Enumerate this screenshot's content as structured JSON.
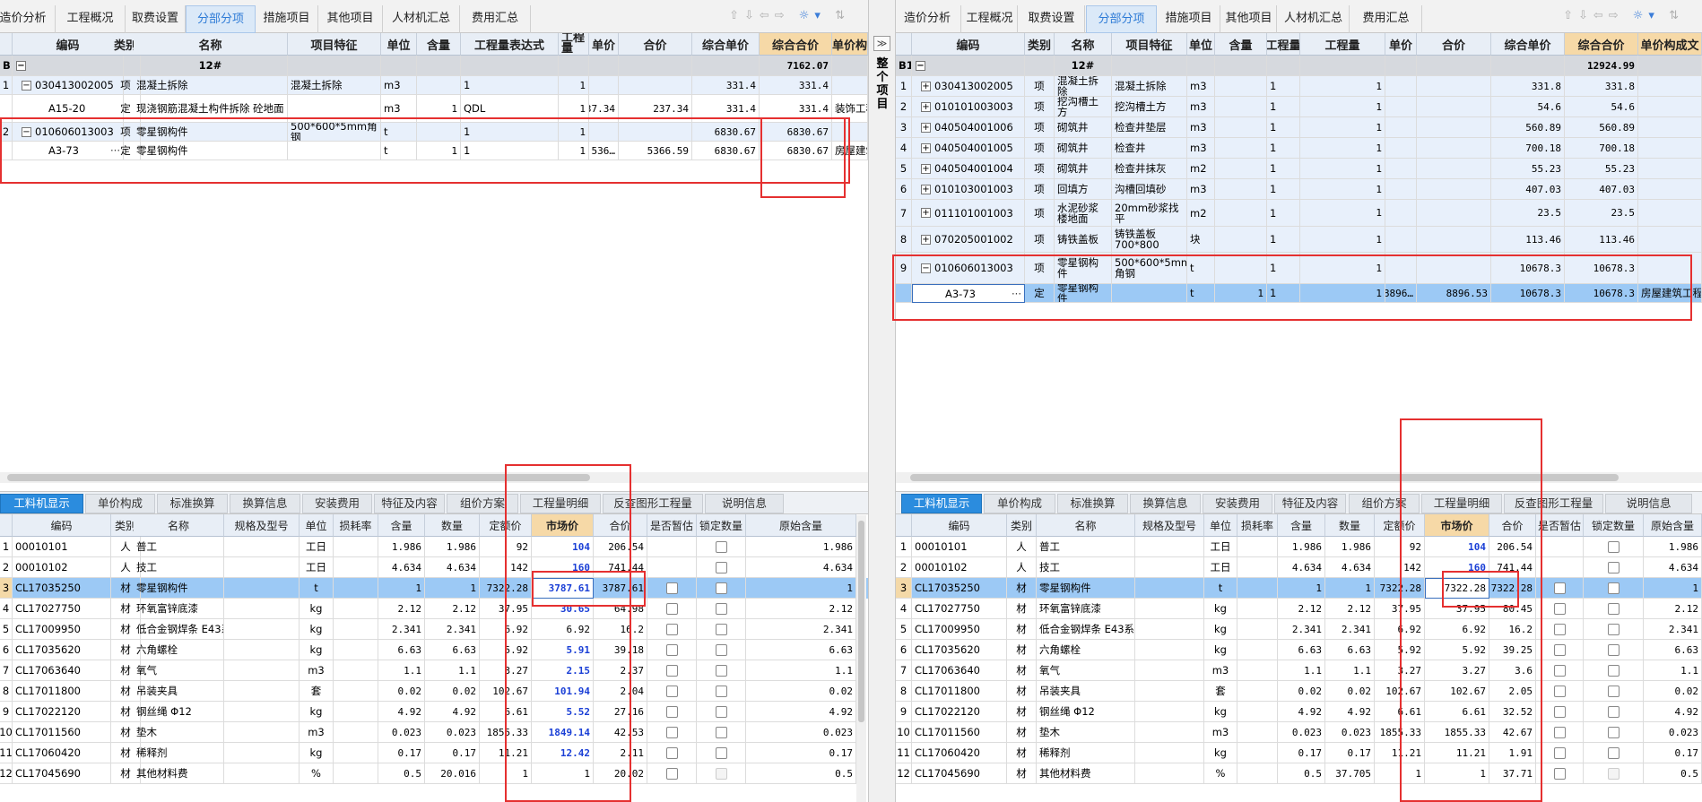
{
  "left": {
    "tabs": [
      "造价分析",
      "工程概况",
      "取费设置",
      "分部分项",
      "措施项目",
      "其他项目",
      "人材机汇总",
      "费用汇总"
    ],
    "active_tab": 3,
    "columns": [
      "",
      "编码",
      "类别",
      "名称",
      "项目特征",
      "单位",
      "含量",
      "工程量表达式",
      "工程量",
      "单价",
      "合价",
      "综合单价",
      "综合合价",
      "单价构"
    ],
    "rows": [
      {
        "idx": "B1",
        "code": "",
        "type": "",
        "name": "12#",
        "feature": "",
        "unit": "",
        "qty_ratio": "",
        "expr": "",
        "qty": "",
        "price": "",
        "total": "",
        "comp_price": "",
        "comp_total": "7162.07",
        "extra": "",
        "kind": "group",
        "toggle": "−"
      },
      {
        "idx": "1",
        "code": "030413002005",
        "type": "项",
        "name": "混凝土拆除",
        "feature": "混凝土拆除",
        "unit": "m3",
        "qty_ratio": "",
        "expr": "1",
        "qty": "1",
        "price": "",
        "total": "",
        "comp_price": "331.4",
        "comp_total": "331.4",
        "extra": "",
        "kind": "item",
        "toggle": "−"
      },
      {
        "idx": "",
        "code": "A15-20",
        "type": "定",
        "name": "现浇钢筋混凝土构件拆除 砼地面",
        "feature": "",
        "unit": "m3",
        "qty_ratio": "1",
        "expr": "QDL",
        "qty": "1",
        "price": "237.34",
        "total": "237.34",
        "comp_price": "331.4",
        "comp_total": "331.4",
        "extra": "装饰工程",
        "kind": "sub",
        "toggle": ""
      },
      {
        "idx": "2",
        "code": "010606013003",
        "type": "项",
        "name": "零星钢构件",
        "feature": "500*600*5mm角钢",
        "unit": "t",
        "qty_ratio": "",
        "expr": "1",
        "qty": "1",
        "price": "",
        "total": "",
        "comp_price": "6830.67",
        "comp_total": "6830.67",
        "extra": "",
        "kind": "item",
        "toggle": "−"
      },
      {
        "idx": "",
        "code": "A3-73",
        "type": "定",
        "name": "零星钢构件",
        "feature": "",
        "unit": "t",
        "qty_ratio": "1",
        "expr": "1",
        "qty": "1",
        "price": "536…",
        "total": "5366.59",
        "comp_price": "6830.67",
        "comp_total": "6830.67",
        "extra": "房屋建筑",
        "kind": "sub-sel",
        "toggle": ""
      }
    ],
    "btabs": [
      "工料机显示",
      "单价构成",
      "标准换算",
      "换算信息",
      "安装费用",
      "特征及内容",
      "组价方案",
      "工程量明细",
      "反查图形工程量",
      "说明信息"
    ],
    "bcolumns": [
      "",
      "编码",
      "类别",
      "名称",
      "规格及型号",
      "单位",
      "损耗率",
      "含量",
      "数量",
      "定额价",
      "市场价",
      "合价",
      "是否暂估",
      "锁定数量",
      "原始含量"
    ],
    "brows": [
      {
        "idx": "1",
        "code": "00010101",
        "type": "人",
        "name": "普工",
        "spec": "",
        "unit": "工日",
        "loss": "",
        "ratio": "1.986",
        "qty": "1.986",
        "quota": "92",
        "market": "104",
        "total": "206.54",
        "orig": "1.986",
        "blue": true
      },
      {
        "idx": "2",
        "code": "00010102",
        "type": "人",
        "name": "技工",
        "spec": "",
        "unit": "工日",
        "loss": "",
        "ratio": "4.634",
        "qty": "4.634",
        "quota": "142",
        "market": "160",
        "total": "741.44",
        "orig": "4.634",
        "blue": true
      },
      {
        "idx": "3",
        "code": "CL17035250",
        "type": "材",
        "name": "零星钢构件",
        "spec": "",
        "unit": "t",
        "loss": "",
        "ratio": "1",
        "qty": "1",
        "quota": "7322.28",
        "market": "3787.61",
        "total": "3787.61",
        "orig": "1",
        "blue": true
      },
      {
        "idx": "4",
        "code": "CL17027750",
        "type": "材",
        "name": "环氧富锌底漆",
        "spec": "",
        "unit": "kg",
        "loss": "",
        "ratio": "2.12",
        "qty": "2.12",
        "quota": "37.95",
        "market": "30.65",
        "total": "64.98",
        "orig": "2.12",
        "blue": true
      },
      {
        "idx": "5",
        "code": "CL17009950",
        "type": "材",
        "name": "低合金钢焊条 E43系列",
        "spec": "",
        "unit": "kg",
        "loss": "",
        "ratio": "2.341",
        "qty": "2.341",
        "quota": "6.92",
        "market": "6.92",
        "total": "16.2",
        "orig": "2.341",
        "blue": false
      },
      {
        "idx": "6",
        "code": "CL17035620",
        "type": "材",
        "name": "六角螺栓",
        "spec": "",
        "unit": "kg",
        "loss": "",
        "ratio": "6.63",
        "qty": "6.63",
        "quota": "5.92",
        "market": "5.91",
        "total": "39.18",
        "orig": "6.63",
        "blue": true
      },
      {
        "idx": "7",
        "code": "CL17063640",
        "type": "材",
        "name": "氧气",
        "spec": "",
        "unit": "m3",
        "loss": "",
        "ratio": "1.1",
        "qty": "1.1",
        "quota": "3.27",
        "market": "2.15",
        "total": "2.37",
        "orig": "1.1",
        "blue": true
      },
      {
        "idx": "8",
        "code": "CL17011800",
        "type": "材",
        "name": "吊装夹具",
        "spec": "",
        "unit": "套",
        "loss": "",
        "ratio": "0.02",
        "qty": "0.02",
        "quota": "102.67",
        "market": "101.94",
        "total": "2.04",
        "orig": "0.02",
        "blue": true
      },
      {
        "idx": "9",
        "code": "CL17022120",
        "type": "材",
        "name": "钢丝绳 Φ12",
        "spec": "",
        "unit": "kg",
        "loss": "",
        "ratio": "4.92",
        "qty": "4.92",
        "quota": "6.61",
        "market": "5.52",
        "total": "27.16",
        "orig": "4.92",
        "blue": true
      },
      {
        "idx": "10",
        "code": "CL17011560",
        "type": "材",
        "name": "垫木",
        "spec": "",
        "unit": "m3",
        "loss": "",
        "ratio": "0.023",
        "qty": "0.023",
        "quota": "1855.33",
        "market": "1849.14",
        "total": "42.53",
        "orig": "0.023",
        "blue": true
      },
      {
        "idx": "11",
        "code": "CL17060420",
        "type": "材",
        "name": "稀释剂",
        "spec": "",
        "unit": "kg",
        "loss": "",
        "ratio": "0.17",
        "qty": "0.17",
        "quota": "11.21",
        "market": "12.42",
        "total": "2.11",
        "orig": "0.17",
        "blue": true
      },
      {
        "idx": "12",
        "code": "CL17045690",
        "type": "材",
        "name": "其他材料费",
        "spec": "",
        "unit": "%",
        "loss": "",
        "ratio": "0.5",
        "qty": "20.016",
        "quota": "1",
        "market": "1",
        "total": "20.02",
        "orig": "0.5",
        "blue": false
      }
    ]
  },
  "splitter": {
    "label": "整个项目",
    "toggle": "≫"
  },
  "right": {
    "tabs": [
      "造价分析",
      "工程概况",
      "取费设置",
      "分部分项",
      "措施项目",
      "其他项目",
      "人材机汇总",
      "费用汇总"
    ],
    "active_tab": 3,
    "columns": [
      "",
      "编码",
      "类别",
      "名称",
      "项目特征",
      "单位",
      "含量",
      "工程量",
      "工程量",
      "单价",
      "合价",
      "综合单价",
      "综合合价",
      "单价构成文"
    ],
    "rows": [
      {
        "idx": "B1",
        "code": "",
        "type": "",
        "name": "12#",
        "feature": "",
        "unit": "",
        "ratio": "",
        "expr": "",
        "qty": "",
        "price": "",
        "total": "",
        "comp_price": "",
        "comp_total": "12924.99",
        "extra": "",
        "kind": "group",
        "toggle": "−"
      },
      {
        "idx": "1",
        "code": "030413002005",
        "type": "项",
        "name": "混凝土拆除",
        "feature": "混凝土拆除",
        "unit": "m3",
        "ratio": "",
        "expr": "1",
        "qty": "1",
        "price": "",
        "total": "",
        "comp_price": "331.8",
        "comp_total": "331.8",
        "extra": "",
        "kind": "item",
        "toggle": "+"
      },
      {
        "idx": "2",
        "code": "010101003003",
        "type": "项",
        "name": "挖沟槽土方",
        "feature": "挖沟槽土方",
        "unit": "m3",
        "ratio": "",
        "expr": "1",
        "qty": "1",
        "price": "",
        "total": "",
        "comp_price": "54.6",
        "comp_total": "54.6",
        "extra": "",
        "kind": "item",
        "toggle": "+"
      },
      {
        "idx": "3",
        "code": "040504001006",
        "type": "项",
        "name": "砌筑井",
        "feature": "检查井垫层",
        "unit": "m3",
        "ratio": "",
        "expr": "1",
        "qty": "1",
        "price": "",
        "total": "",
        "comp_price": "560.89",
        "comp_total": "560.89",
        "extra": "",
        "kind": "item",
        "toggle": "+"
      },
      {
        "idx": "4",
        "code": "040504001005",
        "type": "项",
        "name": "砌筑井",
        "feature": "检查井",
        "unit": "m3",
        "ratio": "",
        "expr": "1",
        "qty": "1",
        "price": "",
        "total": "",
        "comp_price": "700.18",
        "comp_total": "700.18",
        "extra": "",
        "kind": "item",
        "toggle": "+"
      },
      {
        "idx": "5",
        "code": "040504001004",
        "type": "项",
        "name": "砌筑井",
        "feature": "检查井抹灰",
        "unit": "m2",
        "ratio": "",
        "expr": "1",
        "qty": "1",
        "price": "",
        "total": "",
        "comp_price": "55.23",
        "comp_total": "55.23",
        "extra": "",
        "kind": "item",
        "toggle": "+"
      },
      {
        "idx": "6",
        "code": "010103001003",
        "type": "项",
        "name": "回填方",
        "feature": "沟槽回填砂",
        "unit": "m3",
        "ratio": "",
        "expr": "1",
        "qty": "1",
        "price": "",
        "total": "",
        "comp_price": "407.03",
        "comp_total": "407.03",
        "extra": "",
        "kind": "item",
        "toggle": "+"
      },
      {
        "idx": "7",
        "code": "011101001003",
        "type": "项",
        "name": "水泥砂浆楼地面",
        "feature": "20mm砂浆找平",
        "unit": "m2",
        "ratio": "",
        "expr": "1",
        "qty": "1",
        "price": "",
        "total": "",
        "comp_price": "23.5",
        "comp_total": "23.5",
        "extra": "",
        "kind": "item",
        "toggle": "+"
      },
      {
        "idx": "8",
        "code": "070205001002",
        "type": "项",
        "name": "铸铁盖板",
        "feature": "铸铁盖板700*800",
        "unit": "块",
        "ratio": "",
        "expr": "1",
        "qty": "1",
        "price": "",
        "total": "",
        "comp_price": "113.46",
        "comp_total": "113.46",
        "extra": "",
        "kind": "item",
        "toggle": "+"
      },
      {
        "idx": "9",
        "code": "010606013003",
        "type": "项",
        "name": "零星钢构件",
        "feature": "500*600*5mm角钢",
        "unit": "t",
        "ratio": "",
        "expr": "1",
        "qty": "1",
        "price": "",
        "total": "",
        "comp_price": "10678.3",
        "comp_total": "10678.3",
        "extra": "",
        "kind": "item",
        "toggle": "−"
      },
      {
        "idx": "",
        "code": "A3-73",
        "type": "定",
        "name": "零星钢构件",
        "feature": "",
        "unit": "t",
        "ratio": "1",
        "expr": "1",
        "qty": "1",
        "price": "8896…",
        "total": "8896.53",
        "comp_price": "10678.3",
        "comp_total": "10678.3",
        "extra": "房屋建筑工程",
        "kind": "sub-sel",
        "toggle": ""
      }
    ],
    "btabs": [
      "工料机显示",
      "单价构成",
      "标准换算",
      "换算信息",
      "安装费用",
      "特征及内容",
      "组价方案",
      "工程量明细",
      "反查图形工程量",
      "说明信息"
    ],
    "bcolumns": [
      "",
      "编码",
      "类别",
      "名称",
      "规格及型号",
      "单位",
      "损耗率",
      "含量",
      "数量",
      "定额价",
      "市场价",
      "合价",
      "是否暂估",
      "锁定数量",
      "原始含量"
    ],
    "brows": [
      {
        "idx": "1",
        "code": "00010101",
        "type": "人",
        "name": "普工",
        "spec": "",
        "unit": "工日",
        "loss": "",
        "ratio": "1.986",
        "qty": "1.986",
        "quota": "92",
        "market": "104",
        "total": "206.54",
        "orig": "1.986",
        "blue": true
      },
      {
        "idx": "2",
        "code": "00010102",
        "type": "人",
        "name": "技工",
        "spec": "",
        "unit": "工日",
        "loss": "",
        "ratio": "4.634",
        "qty": "4.634",
        "quota": "142",
        "market": "160",
        "total": "741.44",
        "orig": "4.634",
        "blue": true
      },
      {
        "idx": "3",
        "code": "CL17035250",
        "type": "材",
        "name": "零星钢构件",
        "spec": "",
        "unit": "t",
        "loss": "",
        "ratio": "1",
        "qty": "1",
        "quota": "7322.28",
        "market": "7322.28",
        "total": "7322.28",
        "orig": "1",
        "blue": false
      },
      {
        "idx": "4",
        "code": "CL17027750",
        "type": "材",
        "name": "环氧富锌底漆",
        "spec": "",
        "unit": "kg",
        "loss": "",
        "ratio": "2.12",
        "qty": "2.12",
        "quota": "37.95",
        "market": "37.95",
        "total": "80.45",
        "orig": "2.12",
        "blue": false
      },
      {
        "idx": "5",
        "code": "CL17009950",
        "type": "材",
        "name": "低合金钢焊条 E43系列",
        "spec": "",
        "unit": "kg",
        "loss": "",
        "ratio": "2.341",
        "qty": "2.341",
        "quota": "6.92",
        "market": "6.92",
        "total": "16.2",
        "orig": "2.341",
        "blue": false
      },
      {
        "idx": "6",
        "code": "CL17035620",
        "type": "材",
        "name": "六角螺栓",
        "spec": "",
        "unit": "kg",
        "loss": "",
        "ratio": "6.63",
        "qty": "6.63",
        "quota": "5.92",
        "market": "5.92",
        "total": "39.25",
        "orig": "6.63",
        "blue": false
      },
      {
        "idx": "7",
        "code": "CL17063640",
        "type": "材",
        "name": "氧气",
        "spec": "",
        "unit": "m3",
        "loss": "",
        "ratio": "1.1",
        "qty": "1.1",
        "quota": "3.27",
        "market": "3.27",
        "total": "3.6",
        "orig": "1.1",
        "blue": false
      },
      {
        "idx": "8",
        "code": "CL17011800",
        "type": "材",
        "name": "吊装夹具",
        "spec": "",
        "unit": "套",
        "loss": "",
        "ratio": "0.02",
        "qty": "0.02",
        "quota": "102.67",
        "market": "102.67",
        "total": "2.05",
        "orig": "0.02",
        "blue": false
      },
      {
        "idx": "9",
        "code": "CL17022120",
        "type": "材",
        "name": "钢丝绳 Φ12",
        "spec": "",
        "unit": "kg",
        "loss": "",
        "ratio": "4.92",
        "qty": "4.92",
        "quota": "6.61",
        "market": "6.61",
        "total": "32.52",
        "orig": "4.92",
        "blue": false
      },
      {
        "idx": "10",
        "code": "CL17011560",
        "type": "材",
        "name": "垫木",
        "spec": "",
        "unit": "m3",
        "loss": "",
        "ratio": "0.023",
        "qty": "0.023",
        "quota": "1855.33",
        "market": "1855.33",
        "total": "42.67",
        "orig": "0.023",
        "blue": false
      },
      {
        "idx": "11",
        "code": "CL17060420",
        "type": "材",
        "name": "稀释剂",
        "spec": "",
        "unit": "kg",
        "loss": "",
        "ratio": "0.17",
        "qty": "0.17",
        "quota": "11.21",
        "market": "11.21",
        "total": "1.91",
        "orig": "0.17",
        "blue": false
      },
      {
        "idx": "12",
        "code": "CL17045690",
        "type": "材",
        "name": "其他材料费",
        "spec": "",
        "unit": "%",
        "loss": "",
        "ratio": "0.5",
        "qty": "37.705",
        "quota": "1",
        "market": "1",
        "total": "37.71",
        "orig": "0.5",
        "blue": false
      }
    ]
  },
  "colors": {
    "accent": "#2b8cde",
    "highlight_row": "#9cc9f5",
    "annotation": "#e53030",
    "market_header": "#f6d9a7"
  }
}
